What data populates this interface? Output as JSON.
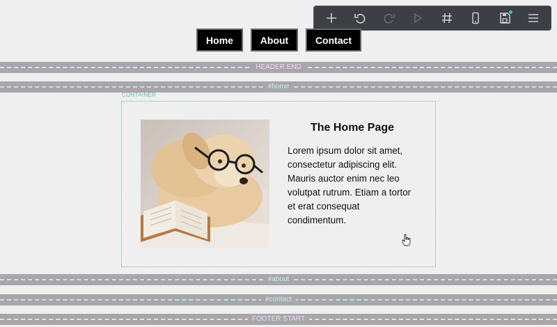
{
  "nav": {
    "items": [
      {
        "label": "Home"
      },
      {
        "label": "About"
      },
      {
        "label": "Contact"
      }
    ]
  },
  "toolbar": {
    "icons": [
      "plus-icon",
      "undo-icon",
      "redo-icon",
      "play-icon",
      "grid-hash-icon",
      "mobile-icon",
      "save-icon",
      "menu-icon"
    ]
  },
  "bands": {
    "header_end": "HEADER END",
    "home": "#home",
    "about": "#about",
    "contact": "#contact",
    "footer_start": "FOOTER START"
  },
  "container_label": "CONTAINER",
  "home": {
    "heading": "The Home Page",
    "paragraph": "Lorem ipsum dolor sit amet, consectetur adipiscing elit. Mauris auctor enim nec leo volutpat rutrum. Etiam a tortor et erat consequat condimentum."
  },
  "colors": {
    "band_gray": "#a8a6aa",
    "teal_accent": "#5fbdb0",
    "pink_accent": "#e6c8ee",
    "toolbar_bg": "#3d3f44",
    "nav_bg": "#000000"
  }
}
